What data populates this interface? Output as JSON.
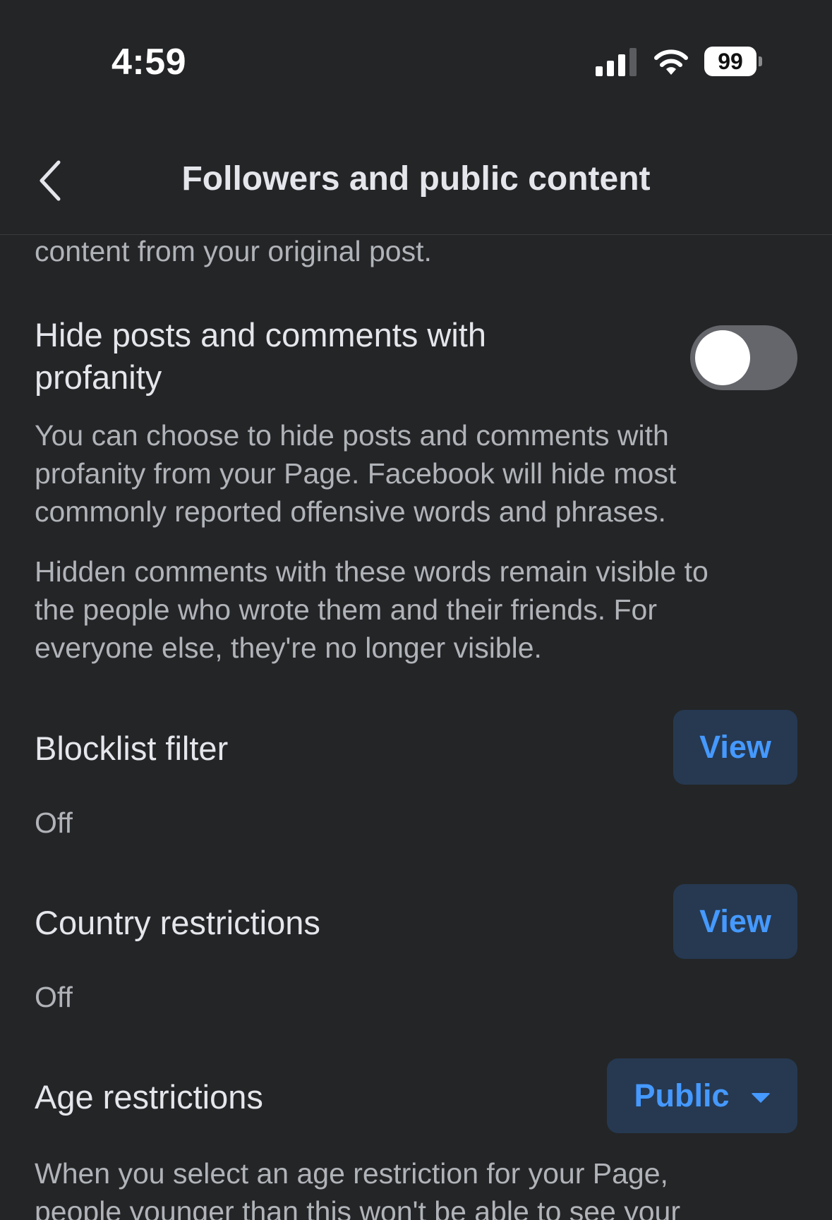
{
  "status_bar": {
    "time": "4:59",
    "battery": "99",
    "icons": [
      "signal-icon",
      "wifi-icon",
      "battery-icon"
    ]
  },
  "header": {
    "title": "Followers and public content",
    "back_icon": "chevron-left-icon"
  },
  "content": {
    "prev_text_tail": "content from your original post.",
    "profanity": {
      "title_line1": "Hide posts and comments with",
      "title_line2": "profanity",
      "toggle_on": false,
      "desc1_line1": "You can choose to hide posts and comments with",
      "desc1_line2": "profanity from your Page. Facebook will hide most",
      "desc1_line3": "commonly reported offensive words and phrases.",
      "desc2_line1": "Hidden comments with these words remain visible to",
      "desc2_line2": "the people who wrote them and their friends. For",
      "desc2_line3": "everyone else, they're no longer visible."
    },
    "blocklist": {
      "title": "Blocklist filter",
      "button_label": "View",
      "status": "Off"
    },
    "country": {
      "title": "Country restrictions",
      "button_label": "View",
      "status": "Off"
    },
    "age": {
      "title": "Age restrictions",
      "dropdown_value": "Public",
      "desc_line1": "When you select an age restriction for your Page,",
      "desc_line2": "people younger than this won't be able to see your"
    }
  },
  "colors": {
    "background": "#242527",
    "accent": "#4599ff",
    "button_bg": "#263951",
    "muted_text": "#b0b3b8"
  }
}
